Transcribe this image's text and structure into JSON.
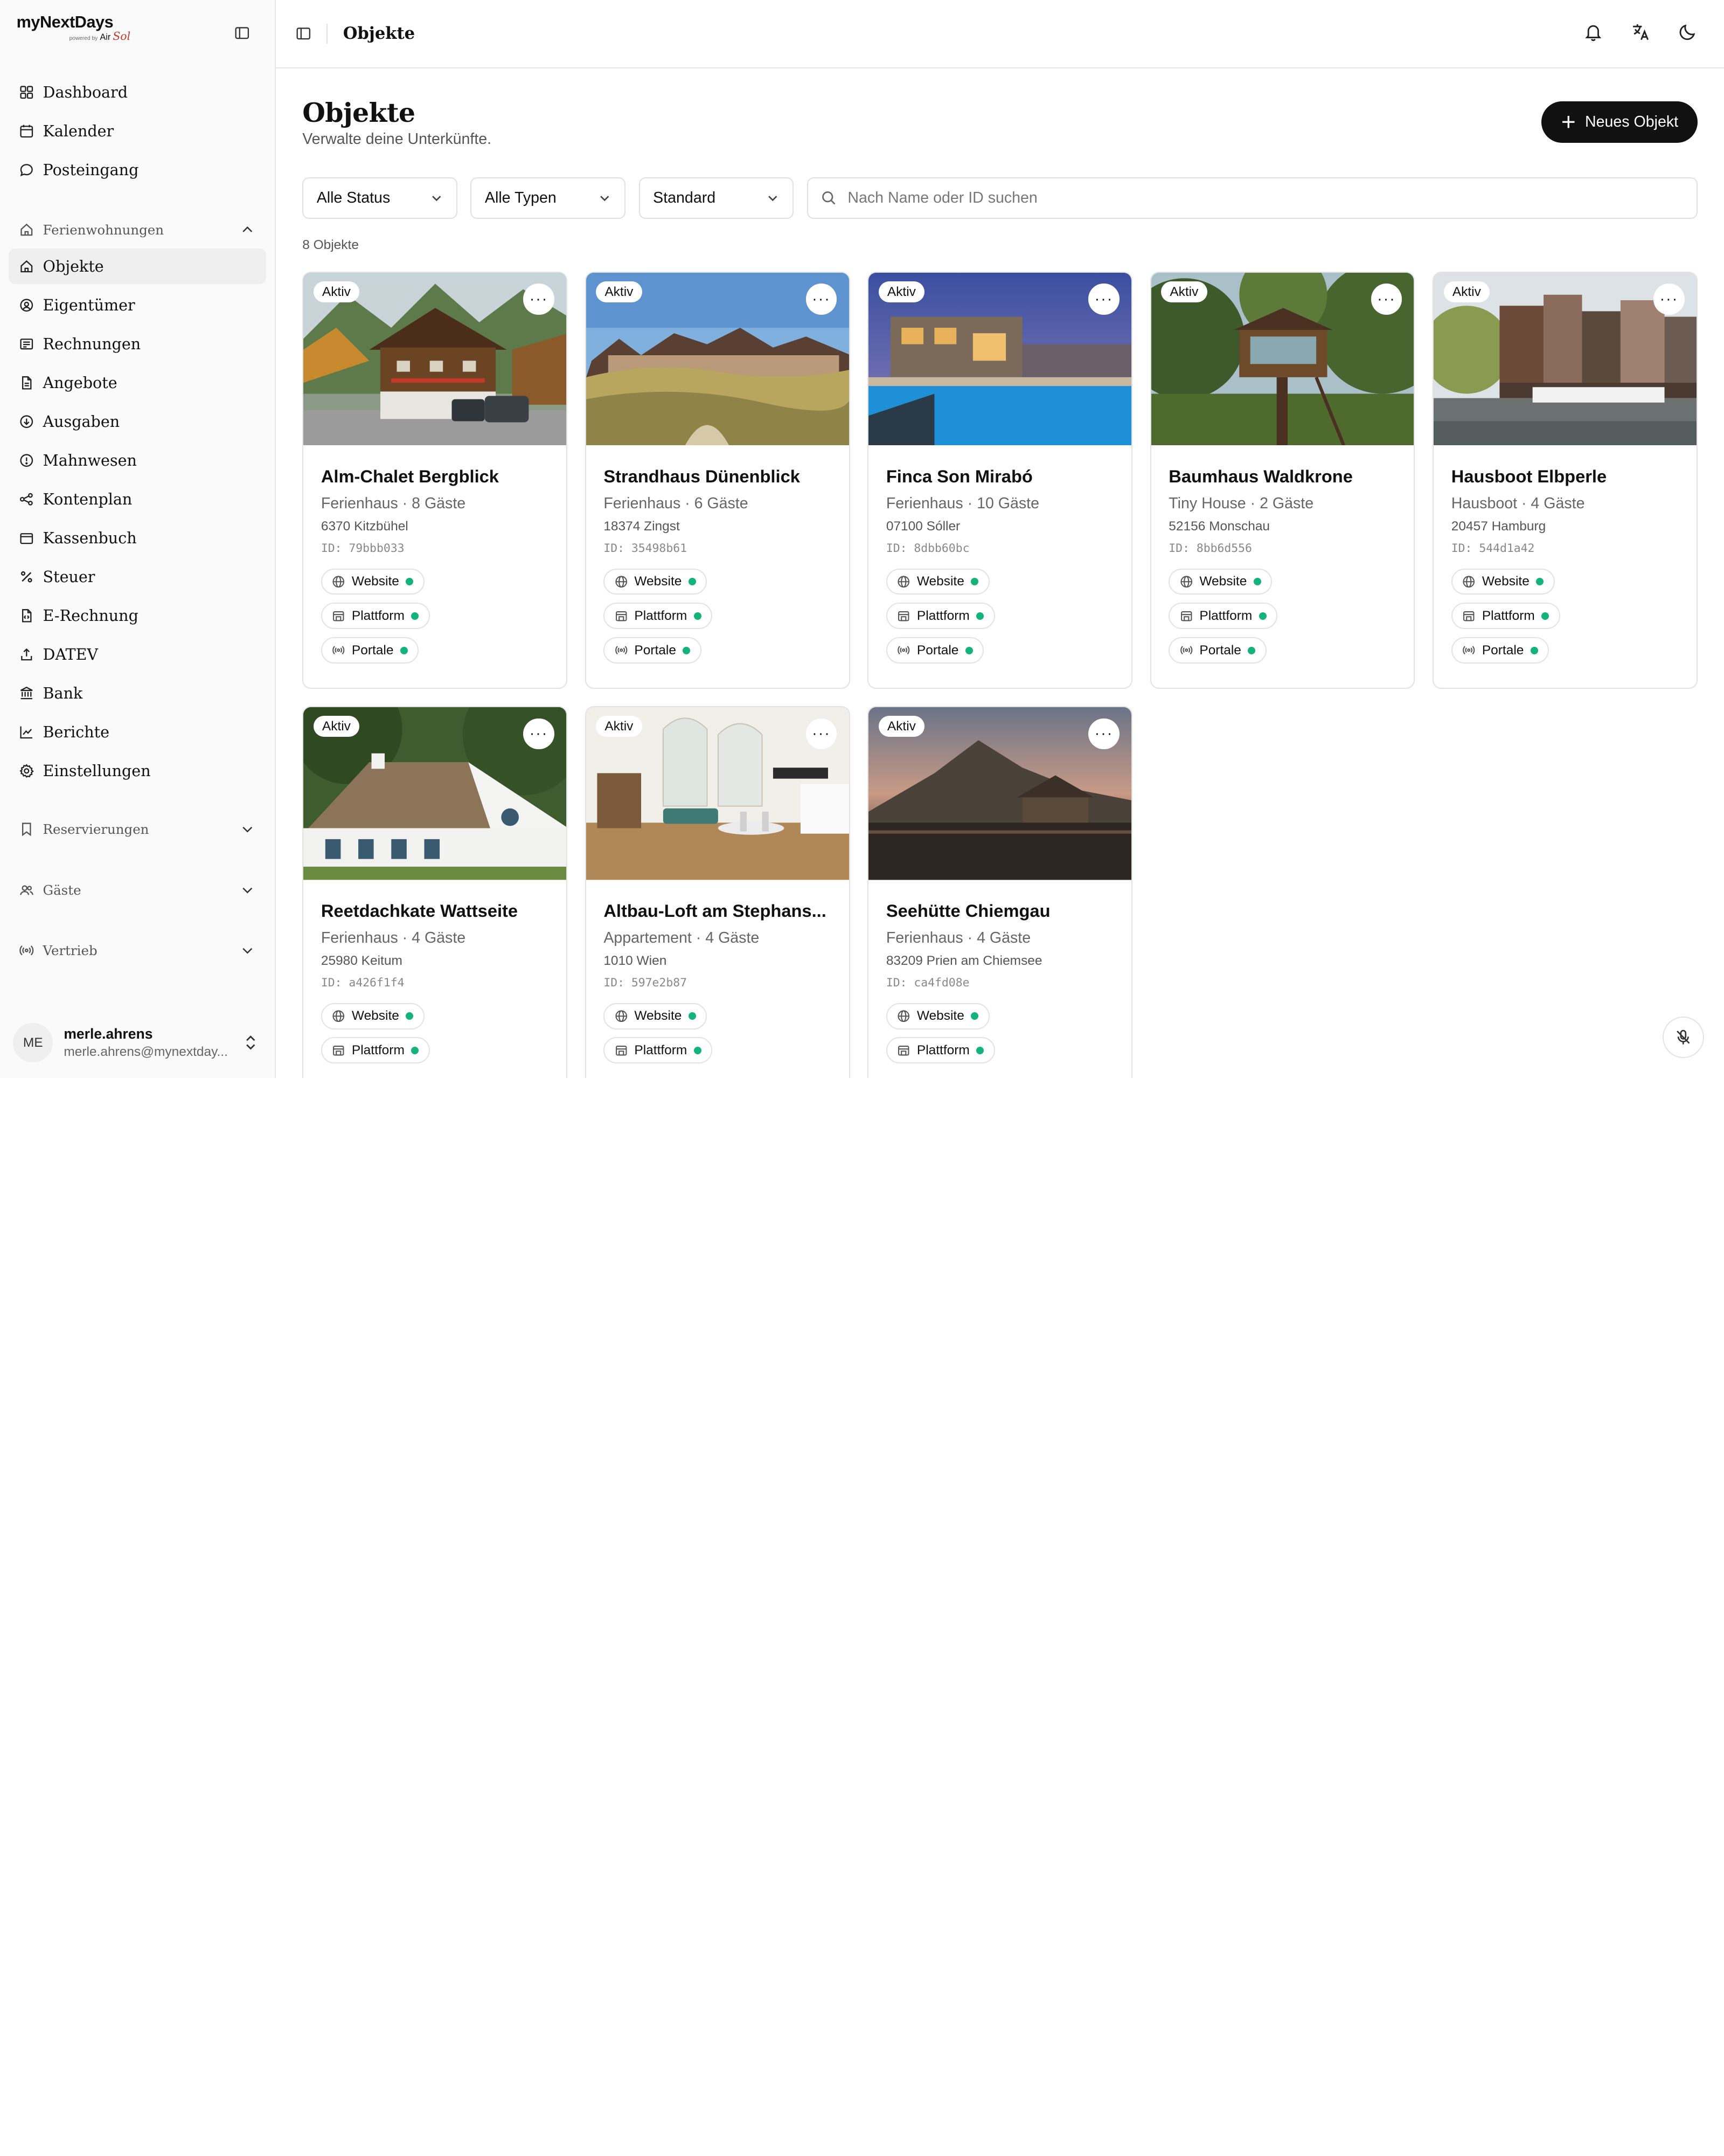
{
  "brand": {
    "title": "myNextDays",
    "powered": "powered by",
    "air": "Air",
    "sol": "Sol"
  },
  "nav": {
    "top": [
      {
        "label": "Dashboard",
        "icon": "grid-icon"
      },
      {
        "label": "Kalender",
        "icon": "calendar-icon"
      },
      {
        "label": "Posteingang",
        "icon": "chat-icon"
      }
    ],
    "group_ferien": "Ferienwohnungen",
    "ferien_items": [
      {
        "label": "Objekte",
        "icon": "home-icon",
        "active": true
      },
      {
        "label": "Eigentümer",
        "icon": "owner-icon"
      },
      {
        "label": "Rechnungen",
        "icon": "invoice-icon"
      },
      {
        "label": "Angebote",
        "icon": "document-icon"
      },
      {
        "label": "Ausgaben",
        "icon": "download-circle-icon"
      },
      {
        "label": "Mahnwesen",
        "icon": "alert-circle-icon"
      },
      {
        "label": "Kontenplan",
        "icon": "network-icon"
      },
      {
        "label": "Kassenbuch",
        "icon": "wallet-icon"
      },
      {
        "label": "Steuer",
        "icon": "percent-icon"
      },
      {
        "label": "E-Rechnung",
        "icon": "file-code-icon"
      },
      {
        "label": "DATEV",
        "icon": "upload-icon"
      },
      {
        "label": "Bank",
        "icon": "bank-icon"
      },
      {
        "label": "Berichte",
        "icon": "chart-line-icon"
      },
      {
        "label": "Einstellungen",
        "icon": "gear-icon"
      }
    ],
    "group_reserv": "Reservierungen",
    "group_gaeste": "Gäste",
    "group_vertrieb": "Vertrieb"
  },
  "user": {
    "initials": "ME",
    "name": "merle.ahrens",
    "email": "merle.ahrens@mynextday..."
  },
  "topbar": {
    "crumb": "Objekte"
  },
  "page": {
    "title": "Objekte",
    "subtitle": "Verwalte deine Unterkünfte.",
    "new_button": "Neues Objekt",
    "filter_status": "Alle Status",
    "filter_type": "Alle Typen",
    "filter_sort": "Standard",
    "search_placeholder": "Nach Name oder ID suchen",
    "count": "8 Objekte"
  },
  "chip_labels": {
    "website": "Website",
    "plattform": "Plattform",
    "portale": "Portale"
  },
  "status_color": "#13b37a",
  "properties": [
    {
      "status": "Aktiv",
      "name": "Alm-Chalet Bergblick",
      "meta": "Ferienhaus · 8 Gäste",
      "location": "6370 Kitzbühel",
      "id": "ID: 79bbb033"
    },
    {
      "status": "Aktiv",
      "name": "Strandhaus Dünenblick",
      "meta": "Ferienhaus · 6 Gäste",
      "location": "18374 Zingst",
      "id": "ID: 35498b61"
    },
    {
      "status": "Aktiv",
      "name": "Finca Son Mirabó",
      "meta": "Ferienhaus · 10 Gäste",
      "location": "07100 Sóller",
      "id": "ID: 8dbb60bc"
    },
    {
      "status": "Aktiv",
      "name": "Baumhaus Waldkrone",
      "meta": "Tiny House · 2 Gäste",
      "location": "52156 Monschau",
      "id": "ID: 8bb6d556"
    },
    {
      "status": "Aktiv",
      "name": "Hausboot Elbperle",
      "meta": "Hausboot · 4 Gäste",
      "location": "20457 Hamburg",
      "id": "ID: 544d1a42"
    },
    {
      "status": "Aktiv",
      "name": "Reetdachkate Wattseite",
      "meta": "Ferienhaus · 4 Gäste",
      "location": "25980 Keitum",
      "id": "ID: a426f1f4"
    },
    {
      "status": "Aktiv",
      "name": "Altbau-Loft am Stephans...",
      "meta": "Appartement · 4 Gäste",
      "location": "1010 Wien",
      "id": "ID: 597e2b87"
    },
    {
      "status": "Aktiv",
      "name": "Seehütte Chiemgau",
      "meta": "Ferienhaus · 4 Gäste",
      "location": "83209 Prien am Chiemsee",
      "id": "ID: ca4fd08e"
    }
  ]
}
